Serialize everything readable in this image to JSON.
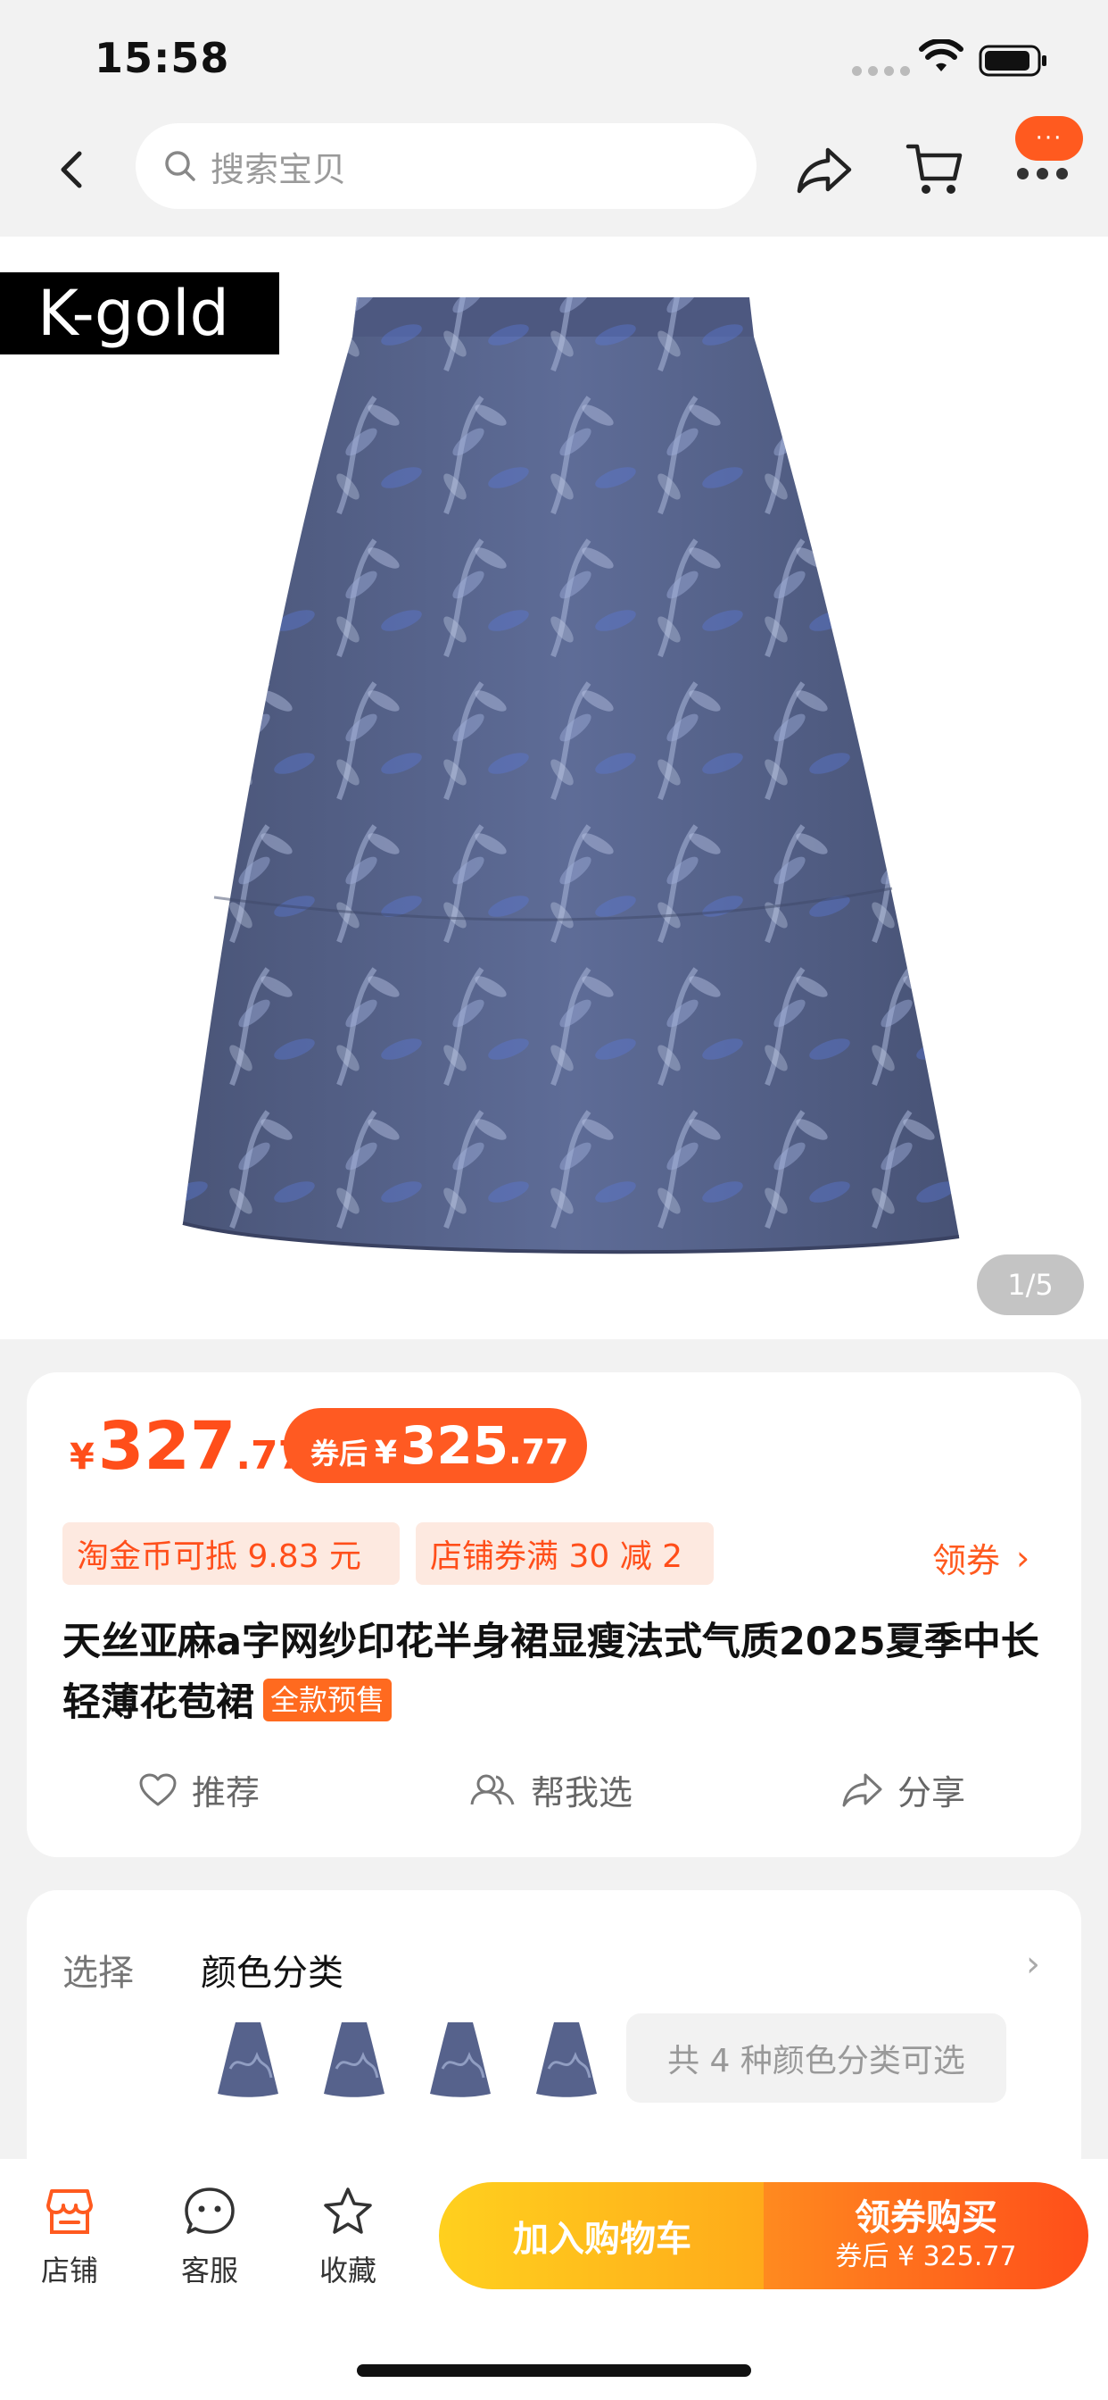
{
  "status": {
    "time": "15:58"
  },
  "nav": {
    "search_placeholder": "搜索宝贝",
    "more_badge": "···"
  },
  "product_image": {
    "brand": "K-gold",
    "page_indicator": "1/5"
  },
  "price": {
    "yen": "¥",
    "integer": "327",
    "decimal": ".77",
    "coupon_label": "券后",
    "coupon_yen": "¥",
    "coupon_integer": "325",
    "coupon_decimal": ".77"
  },
  "tags": {
    "coin": "淘金币可抵 9.83 元",
    "shop_coupon": "店铺券满 30 减 2",
    "get_coupon": "领券",
    "get_coupon_chevron": "›"
  },
  "title": {
    "text": "天丝亚麻a字网纱印花半身裙显瘦法式气质2025夏季中长轻薄花苞裙",
    "badge": "全款预售"
  },
  "actions": {
    "recommend": "推荐",
    "help_choose": "帮我选",
    "share": "分享"
  },
  "select": {
    "label": "选择",
    "title": "颜色分类",
    "chevron": "›",
    "color_count": "共 4 种颜色分类可选"
  },
  "bottom": {
    "shop": "店铺",
    "service": "客服",
    "favorite": "收藏",
    "add_cart": "加入购物车",
    "buy_main": "领券购买",
    "buy_sub": "券后 ¥ 325.77"
  },
  "colors": {
    "accent": "#ff4e1a",
    "cart_gradient": [
      "#ffd01e",
      "#ffaa1a"
    ],
    "buy_gradient": [
      "#ff8a1f",
      "#ff4e1a"
    ]
  }
}
